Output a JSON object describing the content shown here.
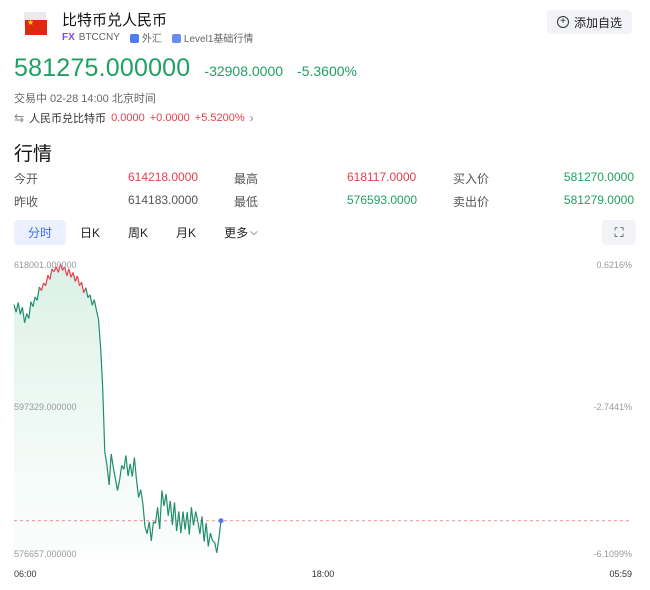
{
  "header": {
    "title": "比特币兑人民币",
    "fx_badge": "FX",
    "symbol": "BTCCNY",
    "market": "外汇",
    "level": "Level1基础行情",
    "add_button": "添加自选"
  },
  "quote": {
    "price": "581275.000000",
    "change": "-32908.0000",
    "change_pct": "-5.3600%",
    "status": "交易中 02-28 14:00 北京时间",
    "reverse_label": "人民币兑比特币",
    "reverse_price": "0.0000",
    "reverse_change": "+0.0000",
    "reverse_pct": "+5.5200%"
  },
  "section_title": "行情",
  "stats": {
    "open_label": "今开",
    "open": "614218.0000",
    "high_label": "最高",
    "high": "618117.0000",
    "bid_label": "买入价",
    "bid": "581270.0000",
    "prev_label": "昨收",
    "prev": "614183.0000",
    "low_label": "最低",
    "low": "576593.0000",
    "ask_label": "卖出价",
    "ask": "581279.0000"
  },
  "tabs": [
    {
      "label": "分时",
      "active": true
    },
    {
      "label": "日K",
      "active": false
    },
    {
      "label": "周K",
      "active": false
    },
    {
      "label": "月K",
      "active": false
    },
    {
      "label": "更多",
      "active": false
    }
  ],
  "more_arrow": "⌵",
  "fullscreen_icon": "⛶",
  "chart_data": {
    "type": "line",
    "y_left_labels": [
      "618001.000000",
      "597329.000000",
      "576657.000000"
    ],
    "y_right_labels": [
      "0.6216%",
      "-2.7441%",
      "-6.1099%"
    ],
    "x_labels": [
      "06:00",
      "18:00",
      "05:59"
    ],
    "ylim": [
      576657,
      618001
    ],
    "prev_close": 614183,
    "current": 581275,
    "series": [
      {
        "values": [
          612200,
          611100,
          612500,
          610800,
          611800,
          609600,
          610900,
          610200,
          612600,
          611900,
          613300,
          612800,
          614700,
          614200,
          615300,
          614900,
          616400,
          615800,
          617300,
          616900,
          617600,
          616800,
          618001,
          617100,
          617600,
          616300,
          617300,
          616100,
          616800,
          615500,
          616300,
          614900,
          615400,
          613900,
          614600,
          613200,
          613600,
          612100,
          612900,
          611400,
          610100,
          606100,
          600300,
          591100,
          589300,
          586400,
          590800,
          588900,
          587300,
          585600,
          587100,
          589200,
          588600,
          590600,
          587700,
          589400,
          587600,
          590300,
          587100,
          584600,
          585700,
          583800,
          580400,
          579400,
          581100,
          578400,
          581100,
          580900,
          583200,
          580100,
          585600,
          583400,
          585100,
          582000,
          584100,
          580700,
          583900,
          579800,
          582600,
          579500,
          582600,
          580000,
          582500,
          579300,
          583200,
          580600,
          582600,
          581200,
          579400,
          581900,
          578300,
          580900,
          577600,
          579500,
          578400,
          578200,
          576700,
          578800,
          581275
        ]
      }
    ]
  }
}
